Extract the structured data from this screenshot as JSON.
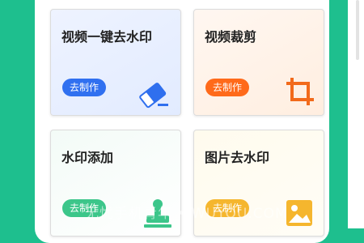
{
  "cards": [
    {
      "title": "视频一键去水印",
      "button": "去制作",
      "icon": "eraser-icon",
      "accent": "#3070f0"
    },
    {
      "title": "视频裁剪",
      "button": "去制作",
      "icon": "crop-icon",
      "accent": "#ff6a1a"
    },
    {
      "title": "水印添加",
      "button": "去制作",
      "icon": "stamp-icon",
      "accent": "#3cc68a"
    },
    {
      "title": "图片去水印",
      "button": "去制作",
      "icon": "image-icon",
      "accent": "#f5b62e"
    }
  ],
  "watermark": "无忧手机青年 • WUYOU.COM"
}
